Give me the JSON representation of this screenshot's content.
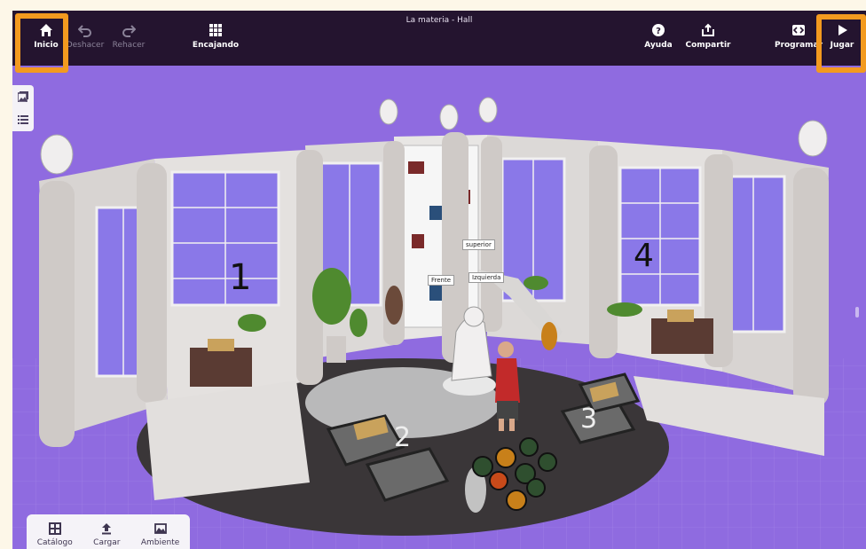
{
  "window": {
    "title": "La materia - Hall"
  },
  "toolbar": {
    "home_label": "Inicio",
    "undo_label": "Deshacer",
    "redo_label": "Rehacer",
    "snap_label": "Encajando",
    "help_label": "Ayuda",
    "share_label": "Compartir",
    "code_label": "Programar",
    "play_label": "Jugar"
  },
  "bottom_panel": {
    "catalog_label": "Catálogo",
    "upload_label": "Cargar",
    "environment_label": "Ambiente"
  },
  "scene": {
    "labels": {
      "superior": "superior",
      "frente": "Frente",
      "izquierda": "Izquierda"
    },
    "numbers": {
      "n1": "1",
      "n2": "2",
      "n3": "3",
      "n4": "4"
    }
  },
  "colors": {
    "topbar": "#24142f",
    "background": "#8f6be0",
    "highlight": "#f39a1f"
  }
}
